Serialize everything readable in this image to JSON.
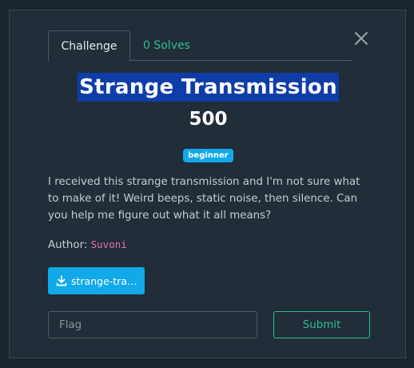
{
  "tabs": [
    {
      "label": "Challenge",
      "active": true
    },
    {
      "label": "0 Solves",
      "active": false
    }
  ],
  "challenge": {
    "title": "Strange Transmission",
    "points": "500",
    "tag": "beginner",
    "description": "I received this strange transmission and I'm not sure what to make of it! Weird beeps, static noise, then silence. Can you help me figure out what it all means?",
    "author_label": "Author:",
    "author_name": "Suvoni",
    "file_label": "strange-tra…"
  },
  "form": {
    "flag_placeholder": "Flag",
    "submit_label": "Submit"
  },
  "colors": {
    "background": "#1a242d",
    "modal": "#212d38",
    "accent_green": "#2bbf95",
    "accent_blue": "#12a9e8",
    "author_pink": "#e773b5",
    "title_highlight": "#0f3da8"
  },
  "icons": {
    "close": "close-icon",
    "download": "download-icon"
  }
}
